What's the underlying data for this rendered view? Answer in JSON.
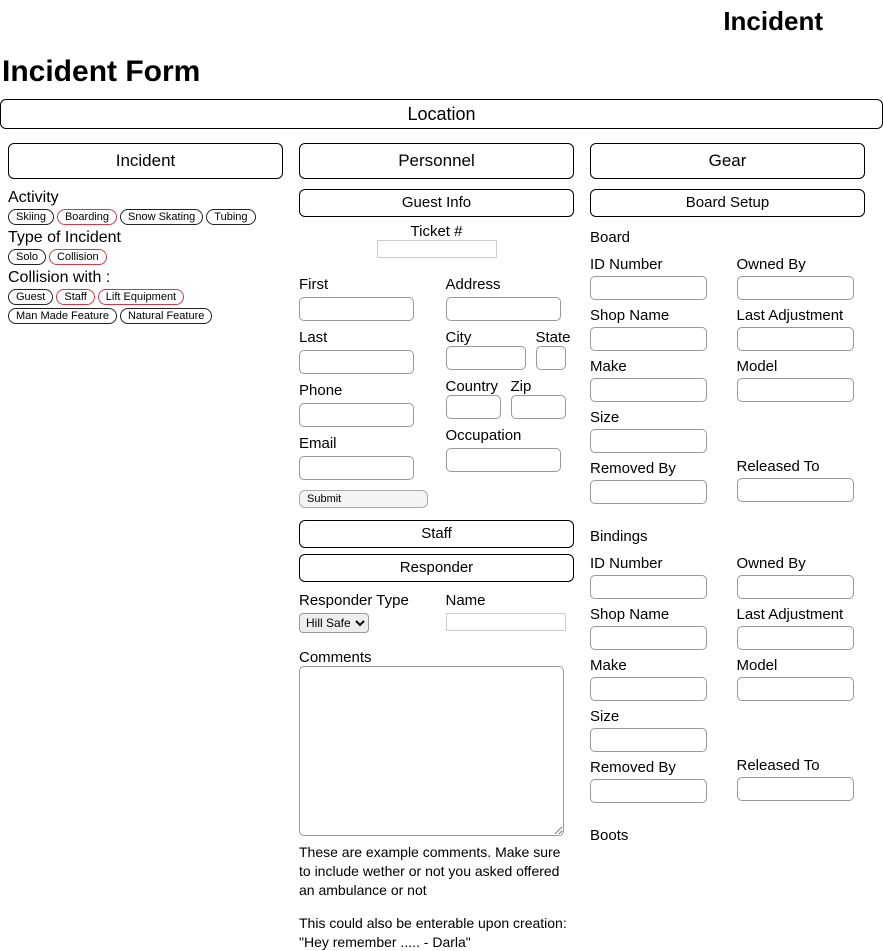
{
  "header": {
    "top_title": "Incident",
    "page_title": "Incident Form"
  },
  "location_bar": "Location",
  "columns": {
    "incident": {
      "title": "Incident",
      "activity_label": "Activity",
      "activity_pills": [
        "Skiing",
        "Boarding",
        "Snow Skating",
        "Tubing"
      ],
      "activity_selected": "Boarding",
      "type_label": "Type of Incident",
      "type_pills": [
        "Solo",
        "Collision"
      ],
      "type_selected": "Collision",
      "collision_label": "Collision with :",
      "collision_pills": [
        "Guest",
        "Staff",
        "Lift Equipment",
        "Man Made Feature",
        "Natural Feature"
      ],
      "collision_selected": [
        "Staff",
        "Lift Equipment"
      ]
    },
    "personnel": {
      "title": "Personnel",
      "guest_info_btn": "Guest Info",
      "ticket_label": "Ticket #",
      "fields": {
        "first": "First",
        "last": "Last",
        "phone": "Phone",
        "email": "Email",
        "address": "Address",
        "city": "City",
        "state": "State",
        "country": "Country",
        "zip": "Zip",
        "occupation": "Occupation"
      },
      "submit": "Submit",
      "staff_btn": "Staff",
      "responder_btn": "Responder",
      "responder_type_label": "Responder Type",
      "responder_type_value": "Hill Safety",
      "name_label": "Name",
      "comments_label": "Comments",
      "note1": "These are example comments. Make sure to include wether or not you asked offered an ambulance or not",
      "note2": "This could also be enterable upon creation: \"Hey remember ..... - Darla\""
    },
    "gear": {
      "title": "Gear",
      "board_setup_btn": "Board Setup",
      "board_title": "Board",
      "bindings_title": "Bindings",
      "boots_title": "Boots",
      "labels": {
        "id_number": "ID Number",
        "owned_by": "Owned By",
        "shop_name": "Shop Name",
        "last_adjustment": "Last Adjustment",
        "make": "Make",
        "model": "Model",
        "size": "Size",
        "removed_by": "Removed By",
        "released_to": "Released To"
      }
    }
  }
}
